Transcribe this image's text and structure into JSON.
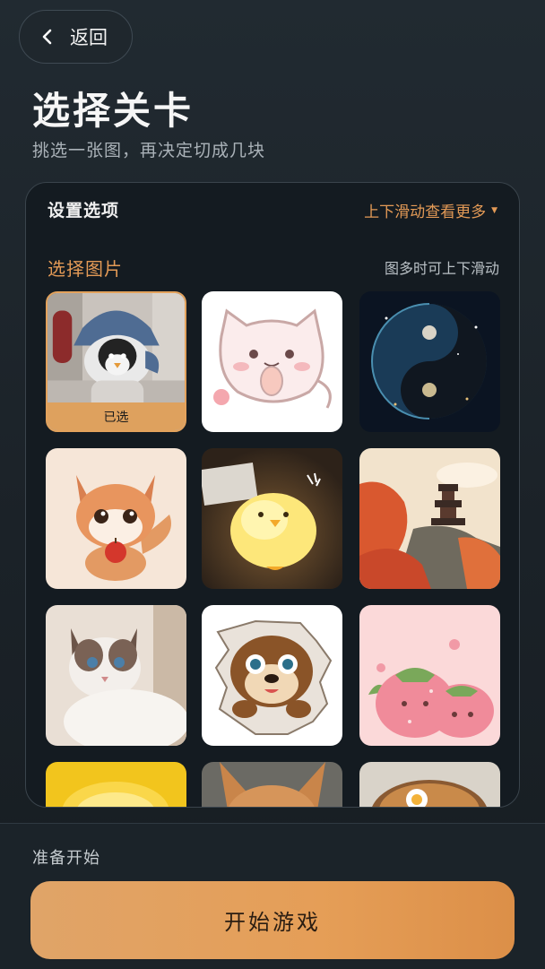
{
  "header": {
    "back_label": "返回",
    "title": "选择关卡",
    "subtitle": "挑选一张图，再决定切成几块"
  },
  "panel": {
    "title": "设置选项",
    "scroll_hint": "上下滑动查看更多"
  },
  "image_section": {
    "title": "选择图片",
    "scroll_hint": "图多时可上下滑动",
    "selected_badge": "已选",
    "images": [
      {
        "subject": "penguin-in-shark-hoodie",
        "selected": true
      },
      {
        "subject": "cat-doodle",
        "selected": false
      },
      {
        "subject": "cosmic-yin-yang",
        "selected": false
      },
      {
        "subject": "fox-with-apple",
        "selected": false
      },
      {
        "subject": "glowing-chick-lamp",
        "selected": false
      },
      {
        "subject": "pagoda-autumn-landscape",
        "selected": false
      },
      {
        "subject": "ragdoll-cat",
        "selected": false
      },
      {
        "subject": "otter-breaking-through",
        "selected": false
      },
      {
        "subject": "strawberry-cats",
        "selected": false
      },
      {
        "subject": "lemon",
        "selected": false
      },
      {
        "subject": "corgi",
        "selected": false
      },
      {
        "subject": "ramen-bowl",
        "selected": false
      }
    ]
  },
  "footer": {
    "label": "准备开始",
    "start_button": "开始游戏"
  },
  "colors": {
    "accent": "#e39a56",
    "button": "#e59e57",
    "background": "#1b2228",
    "panel": "#141b21"
  }
}
